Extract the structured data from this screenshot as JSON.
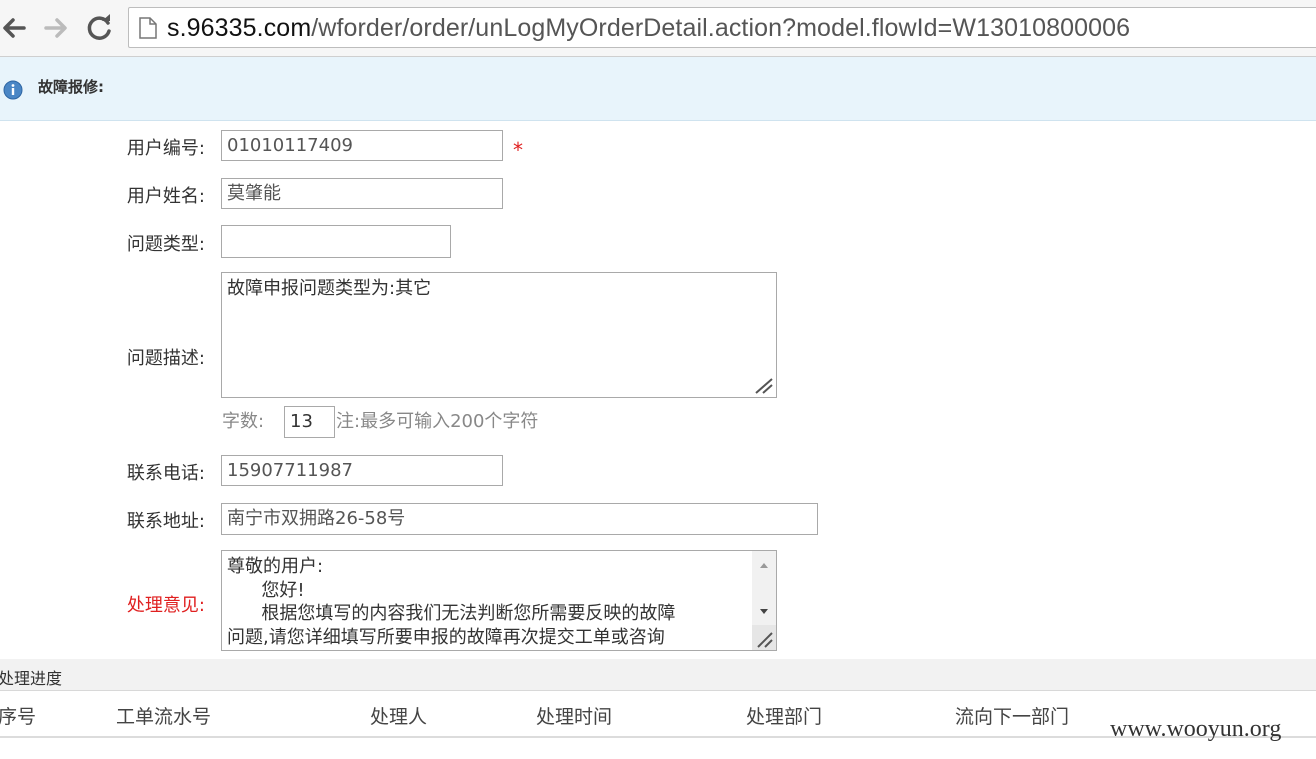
{
  "browser": {
    "url_host": "s.96335.com",
    "url_path": "/wforder/order/unLogMyOrderDetail.action?model.flowId=W13010800006"
  },
  "info_bar": {
    "title": "故障报修:"
  },
  "form": {
    "user_id_label": "用户编号:",
    "user_id_value": "01010117409",
    "required_mark": "*",
    "user_name_label": "用户姓名:",
    "user_name_value": "莫肇能",
    "issue_type_label": "问题类型:",
    "issue_type_value": "",
    "issue_desc_label": "问题描述:",
    "issue_desc_value": "故障申报问题类型为:其它",
    "char_count_label": "字数:",
    "char_count_value": "13",
    "char_count_hint": "注:最多可输入200个字符",
    "phone_label": "联系电话:",
    "phone_value": "15907711987",
    "address_label": "联系地址:",
    "address_value": "南宁市双拥路26-58号",
    "opinion_label": "处理意见:",
    "opinion_value": "尊敬的用户:\n      您好!\n      根据您填写的内容我们无法判断您所需要反映的故障\n问题,请您详细填写所要申报的故障再次提交工单或咨询"
  },
  "progress": {
    "title": "处理进度",
    "columns": [
      "序号",
      "工单流水号",
      "处理人",
      "处理时间",
      "处理部门",
      "流向下一部门"
    ]
  },
  "watermark": "www.wooyun.org",
  "colors": {
    "info_bg": "#e8f4fb",
    "required": "#e02020",
    "label": "#333333"
  }
}
